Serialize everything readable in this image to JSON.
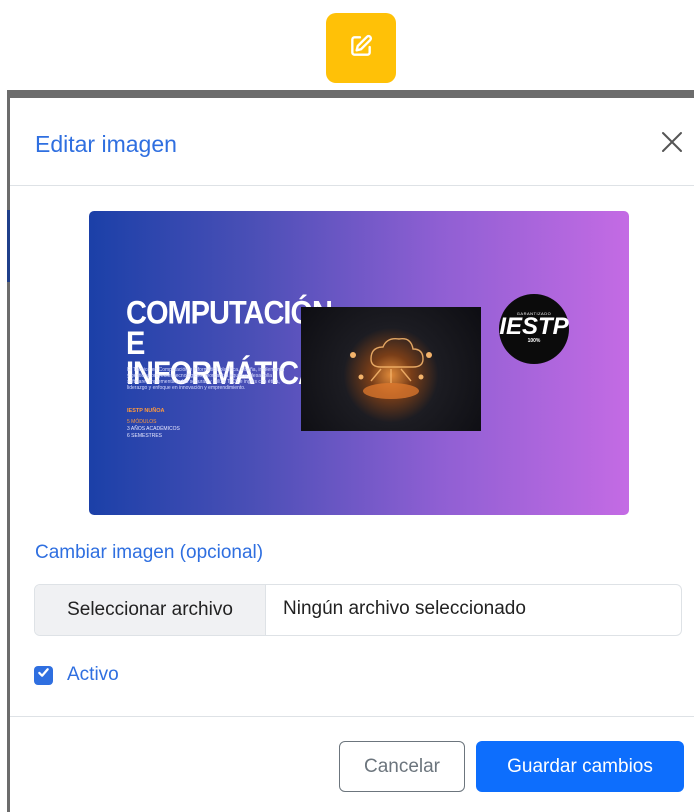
{
  "trigger": {
    "icon": "edit-pencil-icon",
    "color": "#ffc107"
  },
  "modal": {
    "title": "Editar imagen",
    "close_icon": "close-icon"
  },
  "preview": {
    "headline": "COMPUTACIÓN E INFORMÁTICA",
    "body": "El Técnico en Computación e Informática planifica, diseña, implementa y gestiona proyectos tecnológicos, reorganiza equipos, desarrolla software, implementa redes seguras y utiliza TICS e inglés con ética, liderazgo y enfoque en innovación y emprendimiento.",
    "school": "IESTP NUÑOA",
    "modules": "5 MÓDULOS",
    "years": "3 AÑOS ACADÉMICOS",
    "semesters": "6 SEMESTRES",
    "badge_top": "GARANTIZADO",
    "badge_main": "IESTP",
    "badge_pct": "100%"
  },
  "form": {
    "field_label": "Cambiar imagen (opcional)",
    "file_button": "Seleccionar archivo",
    "file_status": "Ningún archivo seleccionado",
    "active_label": "Activo",
    "active_checked": true
  },
  "footer": {
    "cancel_label": "Cancelar",
    "save_label": "Guardar cambios"
  },
  "colors": {
    "primary": "#0d6efd",
    "link_blue": "#2f6fe0",
    "warning": "#ffc107",
    "secondary": "#6c757d"
  }
}
